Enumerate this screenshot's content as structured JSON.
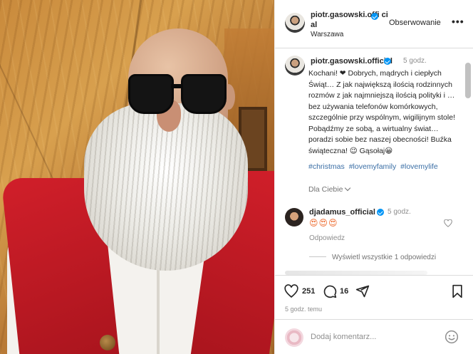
{
  "post": {
    "username": "piotr.gasowski.official",
    "header_username": "piotr.gasowski.offi cial",
    "location": "Warszawa",
    "follow_label": "Obserwowanie",
    "more_label": "•••",
    "caption_time": "5 godz.",
    "caption_text": "Kochani! ❤ Dobrych, mądrych i ciepłych Świąt… Z jak największą ilością rodzinnych rozmów z jak najmniejszą ilością polityki i … bez używania telefonów komórkowych, szczególnie przy wspólnym, wigilijnym stole! Pobądźmy ze sobą, a wirtualny świat… poradzi sobie bez naszej obecności! Buźka świąteczna! 😉 Gąsołaj😀",
    "hashtags": [
      "#christmas",
      "#lovemyfamily",
      "#lovemylife"
    ],
    "for_you_label": "Dla Ciebie"
  },
  "comment": {
    "username": "djadamus_official",
    "time": "5 godz.",
    "text": "😍😍😍",
    "reply_label": "Odpowiedz",
    "view_replies_label": "Wyświetl wszystkie 1 odpowiedzi"
  },
  "actions": {
    "likes": "251",
    "comments": "16",
    "posted_ago": "5 godz. temu"
  },
  "compose": {
    "placeholder": "Dodaj komentarz..."
  },
  "colors": {
    "verified": "#0095f6",
    "hashtag": "#3a6ea5",
    "vest": "#d11f2a"
  },
  "icons": [
    "heart-icon",
    "comment-icon",
    "share-icon",
    "bookmark-icon",
    "emoji-icon",
    "verified-icon",
    "chevron-down-icon"
  ]
}
